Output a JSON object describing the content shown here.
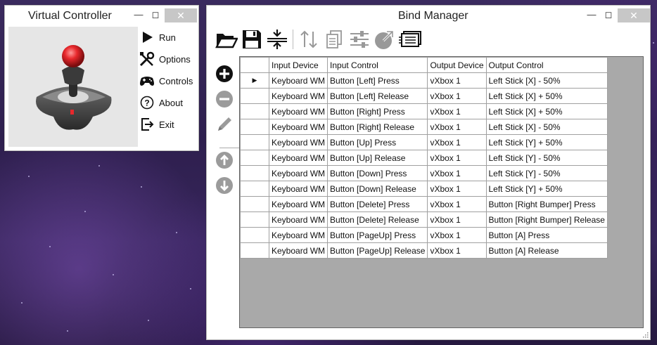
{
  "vc_window": {
    "title": "Virtual Controller",
    "menu": [
      {
        "label": "Run",
        "icon": "play-icon"
      },
      {
        "label": "Options",
        "icon": "tools-icon"
      },
      {
        "label": "Controls",
        "icon": "gamepad-icon"
      },
      {
        "label": "About",
        "icon": "question-icon"
      },
      {
        "label": "Exit",
        "icon": "exit-icon"
      }
    ]
  },
  "bm_window": {
    "title": "Bind Manager",
    "toolbar": [
      "open-folder-icon",
      "save-icon",
      "collapse-icon",
      "sort-icon",
      "copy-icon",
      "sliders-icon",
      "export-icon",
      "list-icon"
    ],
    "sidebar": [
      "add-icon",
      "remove-icon",
      "edit-icon",
      "move-up-icon",
      "move-down-icon"
    ],
    "table": {
      "headers": [
        "Input Device",
        "Input Control",
        "Output Device",
        "Output Control"
      ],
      "selected_row": 0,
      "rows": [
        [
          "Keyboard WM",
          "Button [Left] Press",
          "vXbox 1",
          "Left Stick [X] - 50%"
        ],
        [
          "Keyboard WM",
          "Button [Left] Release",
          "vXbox 1",
          "Left Stick [X] + 50%"
        ],
        [
          "Keyboard WM",
          "Button [Right] Press",
          "vXbox 1",
          "Left Stick [X] + 50%"
        ],
        [
          "Keyboard WM",
          "Button [Right] Release",
          "vXbox 1",
          "Left Stick [X] - 50%"
        ],
        [
          "Keyboard WM",
          "Button [Up] Press",
          "vXbox 1",
          "Left Stick [Y] + 50%"
        ],
        [
          "Keyboard WM",
          "Button [Up] Release",
          "vXbox 1",
          "Left Stick [Y] - 50%"
        ],
        [
          "Keyboard WM",
          "Button [Down] Press",
          "vXbox 1",
          "Left Stick [Y] - 50%"
        ],
        [
          "Keyboard WM",
          "Button [Down] Release",
          "vXbox 1",
          "Left Stick [Y] + 50%"
        ],
        [
          "Keyboard WM",
          "Button [Delete] Press",
          "vXbox 1",
          "Button [Right Bumper] Press"
        ],
        [
          "Keyboard WM",
          "Button [Delete] Release",
          "vXbox 1",
          "Button [Right Bumper] Release"
        ],
        [
          "Keyboard WM",
          "Button [PageUp] Press",
          "vXbox 1",
          "Button [A] Press"
        ],
        [
          "Keyboard WM",
          "Button [PageUp] Release",
          "vXbox 1",
          "Button [A] Release"
        ]
      ]
    }
  },
  "colors": {
    "grid_background": "#a9a9a9",
    "close_button": "#c7c7c7",
    "joystick_knob": "#e8282c"
  }
}
